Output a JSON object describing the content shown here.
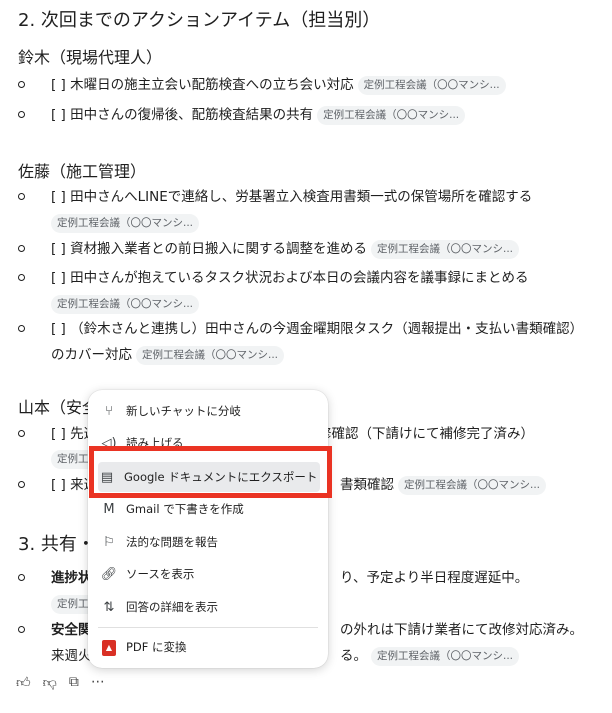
{
  "section2_title": "2. 次回までのアクションアイテム（担当別）",
  "chip_label": "定例工程会議（〇〇マンシ...",
  "groups": {
    "suzuki": {
      "title": "鈴木（現場代理人）",
      "items": [
        "[ ] 木曜日の施主立会い配筋検査への立ち会い対応",
        "[ ] 田中さんの復帰後、配筋検査結果の共有"
      ]
    },
    "sato": {
      "title": "佐藤（施工管理）",
      "items": [
        "[ ] 田中さんへLINEで連絡し、労基署立入検査用書類一式の保管場所を確認する",
        "[ ] 資材搬入業者との前日搬入に関する調整を進める",
        "[ ] 田中さんが抱えているタスク状況および本日の会議内容を議事録にまとめる",
        "[ ] （鈴木さんと連携し）田中さんの今週金曜期限タスク（週報提出・支払い書類確認）",
        "のカバー対応"
      ]
    },
    "yamamoto": {
      "title_visible": "山本（安全",
      "items": [
        "[ ] 先週",
        "修確認（下請けにて補修完了済み）",
        "[ ] 来週",
        "書類確認"
      ]
    }
  },
  "section3": {
    "title_visible": "3. 共有・",
    "items": [
      {
        "bold": "進捗状",
        "rest": "り、予定より半日程度遅延中。"
      },
      {
        "bold": "安全関",
        "rest": "の外れは下請け業者にて改修対応済み。",
        "line2_start": "来週火",
        "line2_end": "る。"
      }
    ]
  },
  "menu": {
    "items": [
      {
        "label": "新しいチャットに分岐",
        "icon": "branch-icon"
      },
      {
        "label": "読み上げる",
        "icon": "speaker-icon"
      },
      {
        "label": "Google ドキュメントにエクスポート",
        "icon": "document-icon"
      },
      {
        "label": "Gmail で下書きを作成",
        "icon": "mail-icon"
      },
      {
        "label": "法的な問題を報告",
        "icon": "flag-icon"
      },
      {
        "label": "ソースを表示",
        "icon": "link-icon"
      },
      {
        "label": "回答の詳細を表示",
        "icon": "details-icon"
      },
      {
        "label": "PDF に変換",
        "icon": "pdf-icon"
      }
    ]
  },
  "footer_icons": [
    "thumbs-up-icon",
    "thumbs-down-icon",
    "copy-icon",
    "more-icon"
  ],
  "colors": {
    "highlight_box": "#ea3323",
    "chip_bg": "#f1f3f4",
    "pdf_red": "#d93025"
  }
}
